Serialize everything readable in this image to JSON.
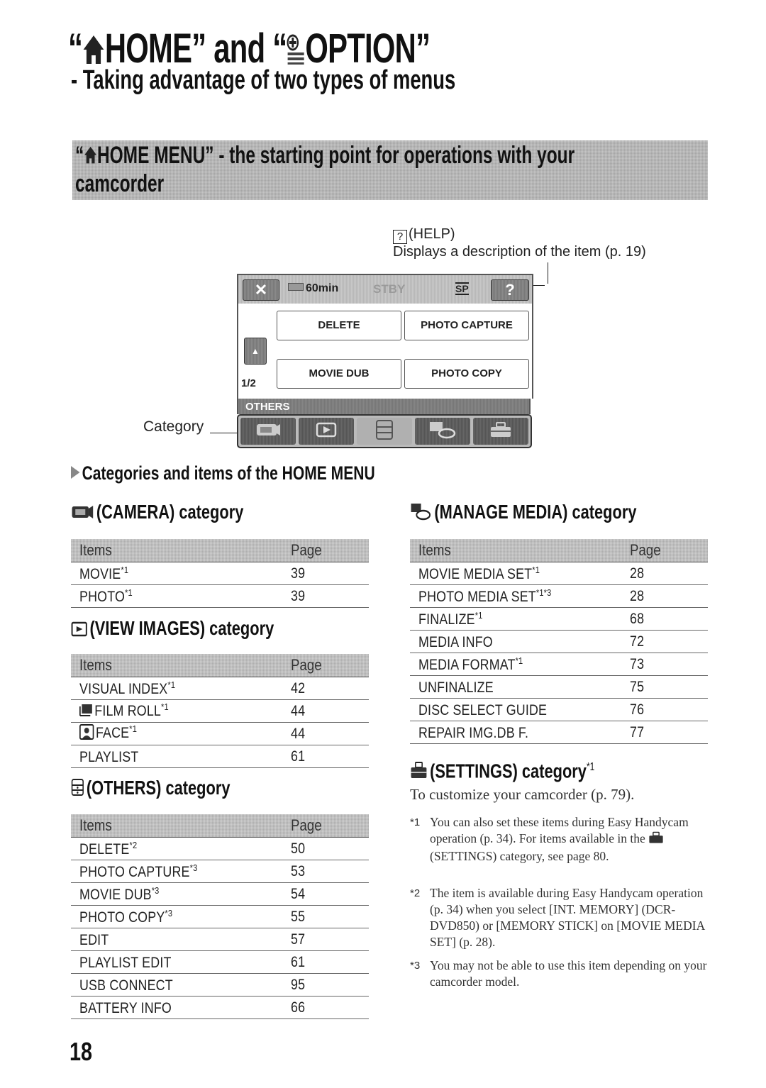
{
  "title": {
    "part1_open_quote": "“",
    "home_word": "HOME",
    "part_mid": "” and “",
    "option_word": "OPTION",
    "close_quote": "”",
    "subtitle": "- Taking advantage of two types of menus"
  },
  "banner": {
    "open_quote": "“",
    "text": "HOME MENU” - the starting point for operations with your",
    "text_line2": "camcorder"
  },
  "help_annotation": {
    "icon_glyph": "?",
    "label": "(HELP)",
    "description": "Displays a description of the item (p. 19)"
  },
  "lcd": {
    "close_glyph": "✕",
    "battery": "60min",
    "status": "STBY",
    "quality": "SP",
    "help_glyph": "?",
    "up_glyph": "▲",
    "down_glyph": "▼",
    "page": "1/2",
    "items": [
      "DELETE",
      "PHOTO CAPTURE",
      "MOVIE DUB",
      "PHOTO COPY"
    ],
    "category_label": "OTHERS",
    "tabs": [
      {
        "icon": "camera-icon",
        "active": false
      },
      {
        "icon": "view-images-icon",
        "active": false
      },
      {
        "icon": "others-icon",
        "active": true
      },
      {
        "icon": "manage-media-icon",
        "active": false
      },
      {
        "icon": "settings-icon",
        "active": false
      }
    ],
    "category_caption": "Category"
  },
  "section_heading": "Categories and items of the HOME MENU",
  "table_header": {
    "items": "Items",
    "page": "Page"
  },
  "categories": {
    "camera": {
      "heading": "(CAMERA) category",
      "rows": [
        {
          "item": "MOVIE",
          "note": "*1",
          "page": "39"
        },
        {
          "item": "PHOTO",
          "note": "*1",
          "page": "39"
        }
      ]
    },
    "view_images": {
      "heading": "(VIEW IMAGES) category",
      "rows": [
        {
          "item": "VISUAL INDEX",
          "note": "*1",
          "page": "42"
        },
        {
          "item": "FILM ROLL",
          "note": "*1",
          "page": "44",
          "icon": "film-roll-icon"
        },
        {
          "item": "FACE",
          "note": "*1",
          "page": "44",
          "icon": "face-icon"
        },
        {
          "item": "PLAYLIST",
          "note": "",
          "page": "61"
        }
      ]
    },
    "others": {
      "heading": "(OTHERS) category",
      "rows": [
        {
          "item": "DELETE",
          "note": "*2",
          "page": "50"
        },
        {
          "item": "PHOTO CAPTURE",
          "note": "*3",
          "page": "53"
        },
        {
          "item": "MOVIE DUB",
          "note": "*3",
          "page": "54"
        },
        {
          "item": "PHOTO COPY",
          "note": "*3",
          "page": "55"
        },
        {
          "item": "EDIT",
          "note": "",
          "page": "57"
        },
        {
          "item": "PLAYLIST EDIT",
          "note": "",
          "page": "61"
        },
        {
          "item": "USB CONNECT",
          "note": "",
          "page": "95"
        },
        {
          "item": "BATTERY INFO",
          "note": "",
          "page": "66"
        }
      ]
    },
    "manage_media": {
      "heading": "(MANAGE MEDIA) category",
      "rows": [
        {
          "item": "MOVIE MEDIA SET",
          "note": "*1",
          "page": "28"
        },
        {
          "item": "PHOTO MEDIA SET",
          "note": "*1*3",
          "page": "28"
        },
        {
          "item": "FINALIZE",
          "note": "*1",
          "page": "68"
        },
        {
          "item": "MEDIA INFO",
          "note": "",
          "page": "72"
        },
        {
          "item": "MEDIA FORMAT",
          "note": "*1",
          "page": "73"
        },
        {
          "item": "UNFINALIZE",
          "note": "",
          "page": "75"
        },
        {
          "item": "DISC SELECT GUIDE",
          "note": "",
          "page": "76"
        },
        {
          "item": "REPAIR IMG.DB F.",
          "note": "",
          "page": "77"
        }
      ]
    },
    "settings": {
      "heading": "(SETTINGS) category",
      "heading_note": "*1",
      "description": "To customize your camcorder (p. 79)."
    }
  },
  "notes": [
    {
      "mark": "*1",
      "text_before_icon": "You can also set these items during Easy Handycam operation (p. 34). For items available in the ",
      "text_after_icon": "(SETTINGS) category, see page 80."
    },
    {
      "mark": "*2",
      "text": "The item is available during Easy Handycam operation (p. 34) when you select [INT. MEMORY] (DCR-DVD850) or [MEMORY STICK] on [MOVIE MEDIA SET] (p. 28)."
    },
    {
      "mark": "*3",
      "text": "You may not be able to use this item depending on your camcorder model."
    }
  ],
  "page_number": "18"
}
